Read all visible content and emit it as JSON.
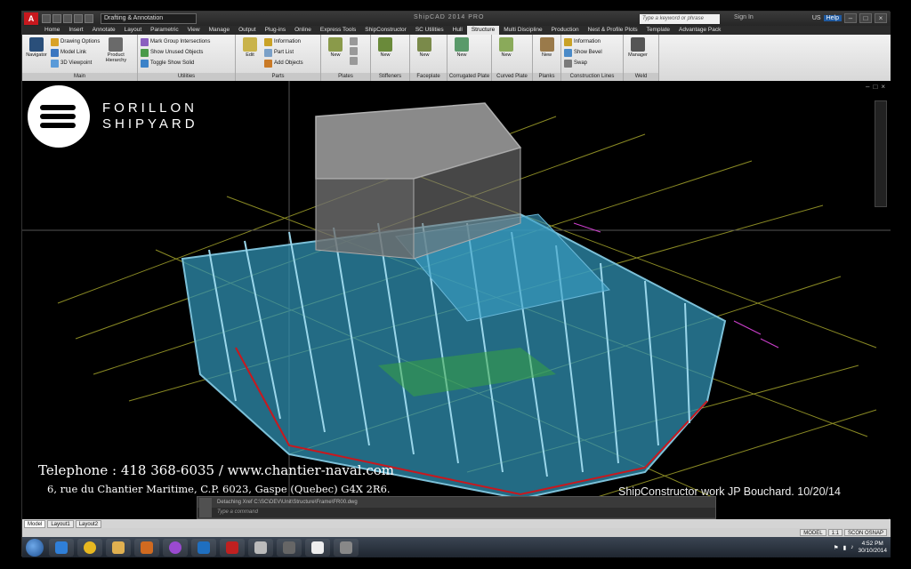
{
  "titlebar": {
    "app_letter": "A",
    "workspace": "Drafting & Annotation",
    "title": "ShipCAD   2014   PRO",
    "search_placeholder": "Type a keyword or phrase",
    "sign_in": "Sign In",
    "region": "US",
    "help": "Help"
  },
  "tabs": [
    "Home",
    "Insert",
    "Annotate",
    "Layout",
    "Parametric",
    "View",
    "Manage",
    "Output",
    "Plug-ins",
    "Online",
    "Express Tools",
    "ShipConstructor",
    "SC Utilities",
    "Hull",
    "Structure",
    "Multi Discipline",
    "Production",
    "Nest & Profile Plots",
    "Template",
    "Advantage Pack"
  ],
  "active_tab": "Structure",
  "ribbon": {
    "main": {
      "title": "Main",
      "navigator": "Navigator",
      "drawing_options": "Drawing Options",
      "model_link": "Model Link",
      "viewpoint": "3D Viewpoint",
      "product_hierarchy": "Product Hierarchy"
    },
    "utilities": {
      "title": "Utilities",
      "mark_group": "Mark Group Intersections",
      "show_unused": "Show Unused Objects",
      "toggle_show": "Toggle Show Solid"
    },
    "parts": {
      "title": "Parts",
      "edit": "Edit",
      "information": "Information",
      "part_list": "Part List",
      "add_objects": "Add Objects"
    },
    "plates": {
      "title": "Plates",
      "new": "New"
    },
    "stiffeners": {
      "title": "Stiffeners",
      "new": "New"
    },
    "faceplate": {
      "title": "Faceplate",
      "new": "New"
    },
    "corrugated": {
      "title": "Corrugated Plate",
      "new": "New"
    },
    "curved": {
      "title": "Curved Plate",
      "new": "New"
    },
    "planks": {
      "title": "Planks",
      "new": "New"
    },
    "construction": {
      "title": "Construction Lines",
      "information": "Information",
      "show_bevel": "Show Bevel",
      "swap": "Swap"
    },
    "weld": {
      "title": "Weld",
      "manager": "Manager"
    }
  },
  "overlay": {
    "brand_line1": "FORILLON",
    "brand_line2": "SHIPYARD",
    "telephone": "Telephone : 418 368-6035 / www.chantier-naval.com",
    "address": "6, rue du Chantier Maritime, C.P. 6023, Gaspe (Quebec) G4X 2R6.",
    "credit": "ShipConstructor work JP Bouchard. 10/20/14"
  },
  "command": {
    "history": "Detaching Xref C:\\SC\\DEV\\Unit\\Structure\\Frame\\FR00.dwg",
    "placeholder": "Type a command"
  },
  "layout_tabs": [
    "Model",
    "Layout1",
    "Layout2"
  ],
  "status": {
    "model": "MODEL",
    "scale": "1:1",
    "osnap": "SCON OSNAP"
  },
  "taskbar": {
    "time": "4:52 PM",
    "date": "30/10/2014"
  },
  "colors": {
    "hull": "#2f8fb0",
    "cabin": "#8a8a8a",
    "frames": "#7cc0d8",
    "bg": "#000000",
    "accent": "#c8181e"
  }
}
